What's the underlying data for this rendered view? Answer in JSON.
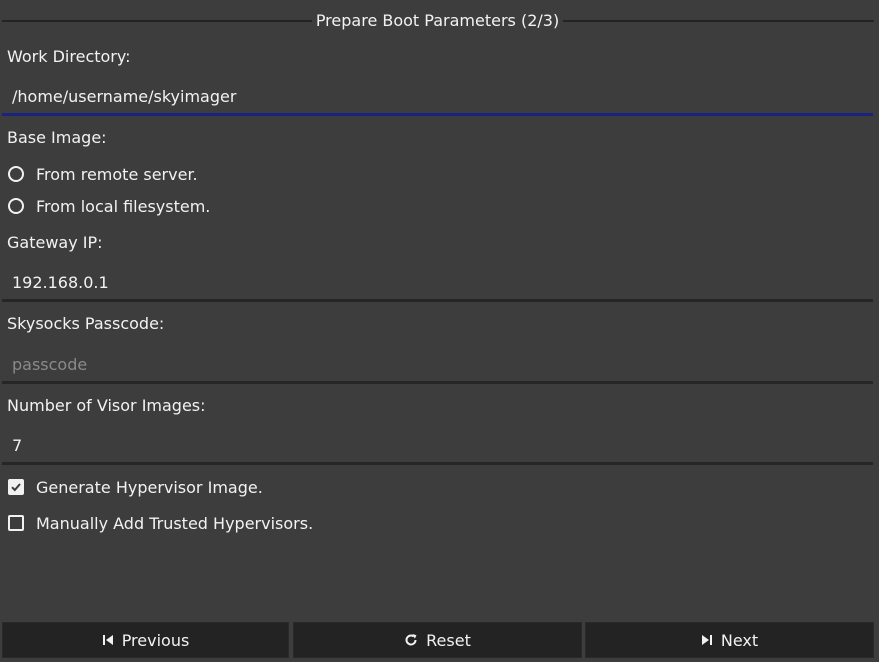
{
  "header": {
    "title": "Prepare Boot Parameters (2/3)"
  },
  "work_directory": {
    "label": "Work Directory:",
    "value": "/home/username/skyimager"
  },
  "base_image": {
    "label": "Base Image:",
    "options": [
      {
        "label": "From remote server.",
        "selected": false
      },
      {
        "label": "From local filesystem.",
        "selected": false
      }
    ]
  },
  "gateway_ip": {
    "label": "Gateway IP:",
    "value": "192.168.0.1"
  },
  "skysocks_passcode": {
    "label": "Skysocks Passcode:",
    "value": "",
    "placeholder": "passcode"
  },
  "visor_images": {
    "label": "Number of Visor Images:",
    "value": "7"
  },
  "options": {
    "generate_hypervisor": {
      "label": "Generate Hypervisor Image.",
      "checked": true
    },
    "manual_trusted": {
      "label": "Manually Add Trusted Hypervisors.",
      "checked": false
    }
  },
  "footer": {
    "previous_label": "Previous",
    "reset_label": "Reset",
    "next_label": "Next"
  },
  "colors": {
    "background": "#3d3d3d",
    "button_bg": "#232323",
    "focus_underline": "#1a237e",
    "text": "#f2f2f2",
    "placeholder": "#8a8a8a"
  },
  "icons": {
    "previous": "skip-previous-icon",
    "reset": "refresh-icon",
    "next": "skip-next-icon"
  }
}
